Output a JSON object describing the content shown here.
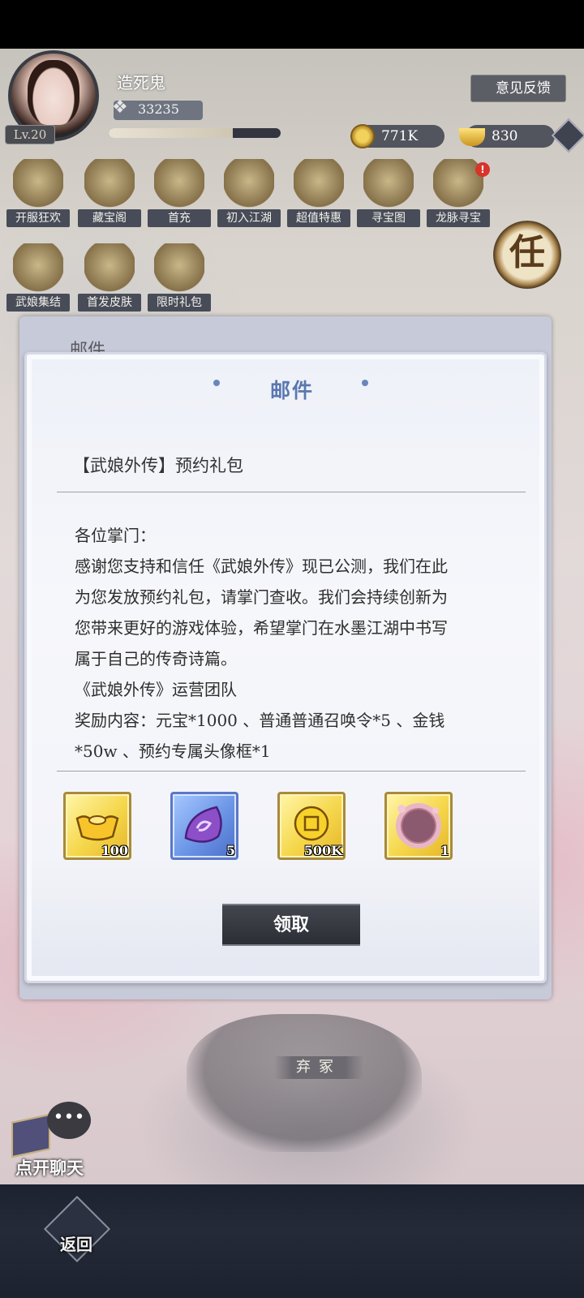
{
  "player": {
    "name": "造死鬼",
    "level": "Lv.20",
    "power": "33235",
    "exp_fraction": 0.72
  },
  "header": {
    "feedback_label": "意见反馈",
    "coins": "771K",
    "ingots": "830"
  },
  "events": [
    {
      "label": "开服狂欢",
      "icon": "scroll-icon"
    },
    {
      "label": "藏宝阁",
      "icon": "pavilion-icon"
    },
    {
      "label": "首充",
      "icon": "gift-box-icon"
    },
    {
      "label": "初入江湖",
      "icon": "yin-yang-icon"
    },
    {
      "label": "超值特惠",
      "icon": "treasure-pile-icon"
    },
    {
      "label": "寻宝图",
      "icon": "treasure-map-icon"
    },
    {
      "label": "龙脉寻宝",
      "icon": "compass-icon",
      "badge": "!"
    },
    {
      "label": "武娘集结",
      "icon": "token-icon"
    },
    {
      "label": "首发皮肤",
      "icon": "heroine-portrait-icon"
    },
    {
      "label": "限时礼包",
      "icon": "gift-bag-icon"
    }
  ],
  "task_label": "任",
  "mail_panel": {
    "back_title": "邮件",
    "title": "邮件",
    "subject": "【武娘外传】预约礼包",
    "body_lines": [
      "各位掌门：",
      "感谢您支持和信任《武娘外传》现已公测，我们在此",
      "为您发放预约礼包，请掌门查收。我们会持续创新为",
      "您带来更好的游戏体验，希望掌门在水墨江湖中书写",
      "属于自己的传奇诗篇。",
      "《武娘外传》运营团队",
      "奖励内容：元宝*1000 、普通普通召唤令*5 、金钱",
      "*50w 、预约专属头像框*1"
    ],
    "rewards": [
      {
        "count": "100",
        "icon": "gold-ingot-icon",
        "rarity": "gold"
      },
      {
        "count": "5",
        "icon": "summon-token-icon",
        "rarity": "blue"
      },
      {
        "count": "500K",
        "icon": "gold-coin-icon",
        "rarity": "gold"
      },
      {
        "count": "1",
        "icon": "avatar-frame-icon",
        "rarity": "gold"
      }
    ],
    "claim_label": "领取"
  },
  "scene": {
    "location_tag": "弃冢"
  },
  "chat": {
    "label": "点开聊天",
    "bubble": "•••"
  },
  "nav": {
    "back_label": "返回"
  }
}
